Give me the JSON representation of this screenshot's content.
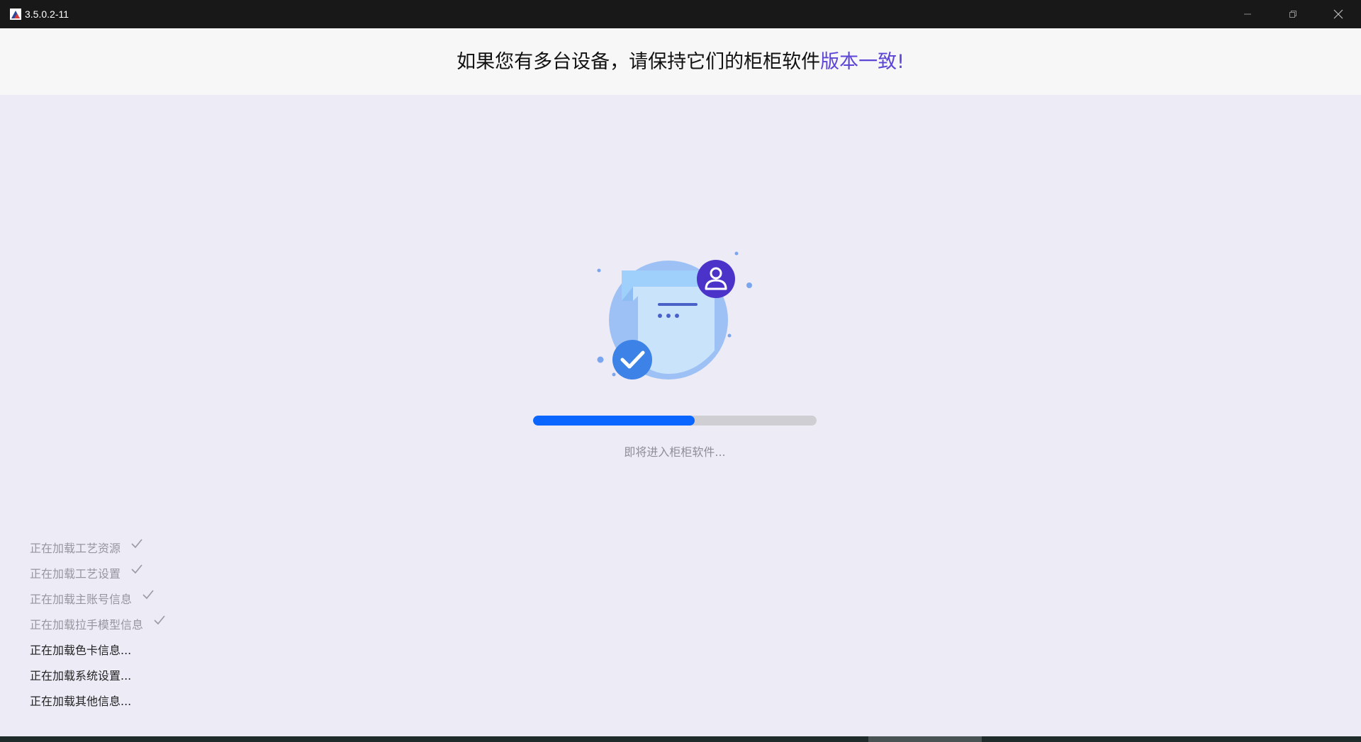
{
  "window": {
    "title": "3.5.0.2-11",
    "icon": "app-logo-icon",
    "controls": [
      "minimize-icon",
      "restore-icon",
      "close-icon"
    ]
  },
  "banner": {
    "text_main": "如果您有多台设备，请保持它们的柜柜软件",
    "text_highlight": "版本一致!",
    "highlight_color": "#5b46d6"
  },
  "illustration": {
    "icon": "document-user-check-icon"
  },
  "progress": {
    "value": 0.57,
    "color": "#0a66ff",
    "status_text": "即将进入柜柜软件..."
  },
  "tasks": [
    {
      "label": "正在加载工艺资源",
      "done": true
    },
    {
      "label": "正在加载工艺设置",
      "done": true
    },
    {
      "label": "正在加载主账号信息",
      "done": true
    },
    {
      "label": "正在加载拉手模型信息",
      "done": true
    },
    {
      "label": "正在加载色卡信息...",
      "done": false
    },
    {
      "label": "正在加载系统设置...",
      "done": false
    },
    {
      "label": "正在加载其他信息...",
      "done": false
    }
  ]
}
